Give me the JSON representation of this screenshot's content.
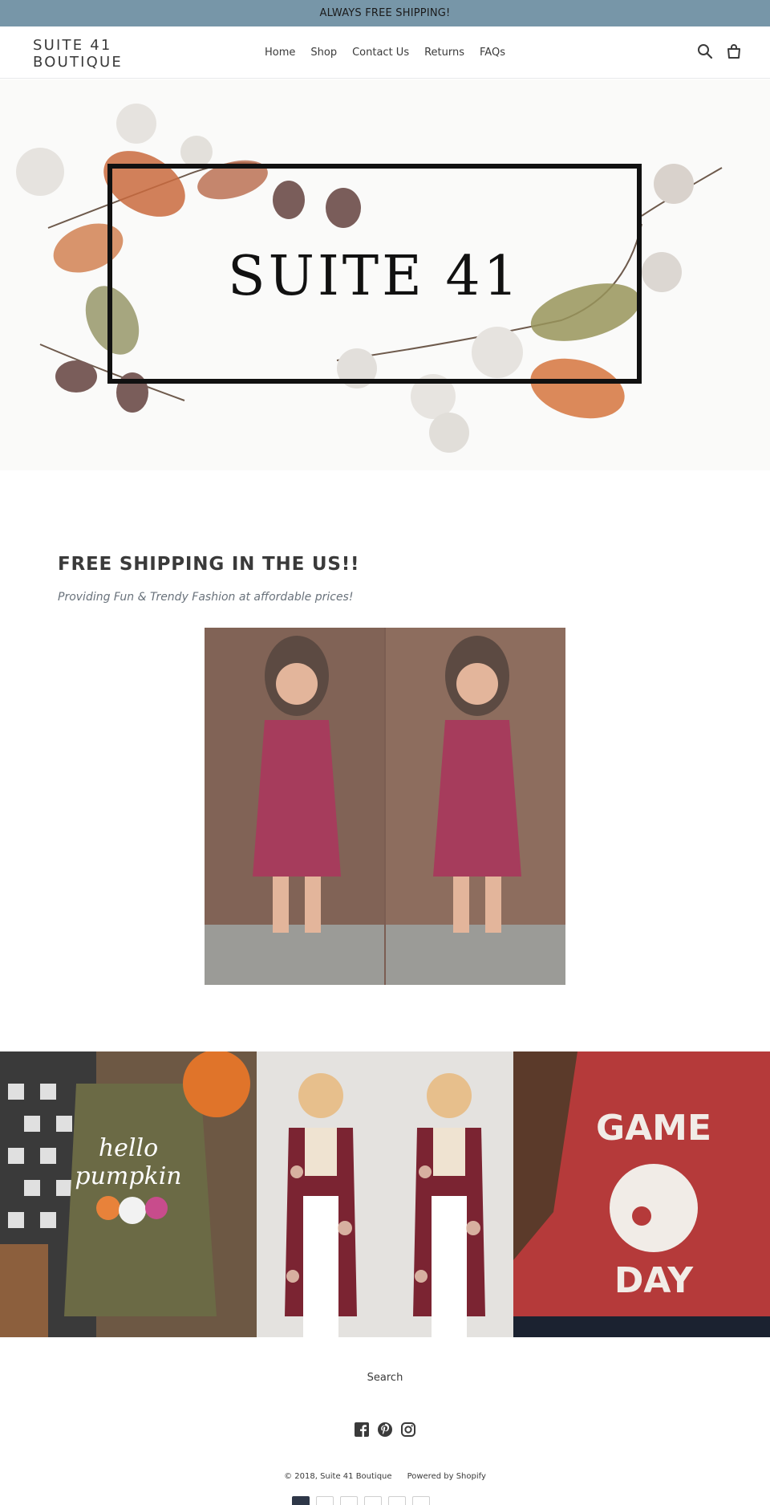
{
  "announcement": "ALWAYS FREE SHIPPING!",
  "header": {
    "logo_line1": "SUITE 41",
    "logo_line2": "BOUTIQUE",
    "nav": [
      "Home",
      "Shop",
      "Contact Us",
      "Returns",
      "FAQs"
    ],
    "icons": [
      "search-icon",
      "cart-icon"
    ]
  },
  "hero": {
    "banner_text": "SUITE 41"
  },
  "rich_text": {
    "title": "FREE SHIPPING IN THE US!!",
    "subtitle": "Providing Fun & Trendy Fashion at affordable prices!"
  },
  "collage": {
    "tile1_text_line1": "hello",
    "tile1_text_line2": "pumpkin",
    "tile3_text_line1": "GAME",
    "tile3_text_line2": "DAY"
  },
  "footer": {
    "search_link": "Search",
    "social_icons": [
      "facebook-icon",
      "pinterest-icon",
      "instagram-icon"
    ],
    "copyright": "© 2018, Suite 41 Boutique",
    "powered": "Powered by Shopify"
  },
  "colors": {
    "announcement_bg": "#7796a8",
    "text": "#3a3a3a",
    "subtitle": "#69727b"
  }
}
